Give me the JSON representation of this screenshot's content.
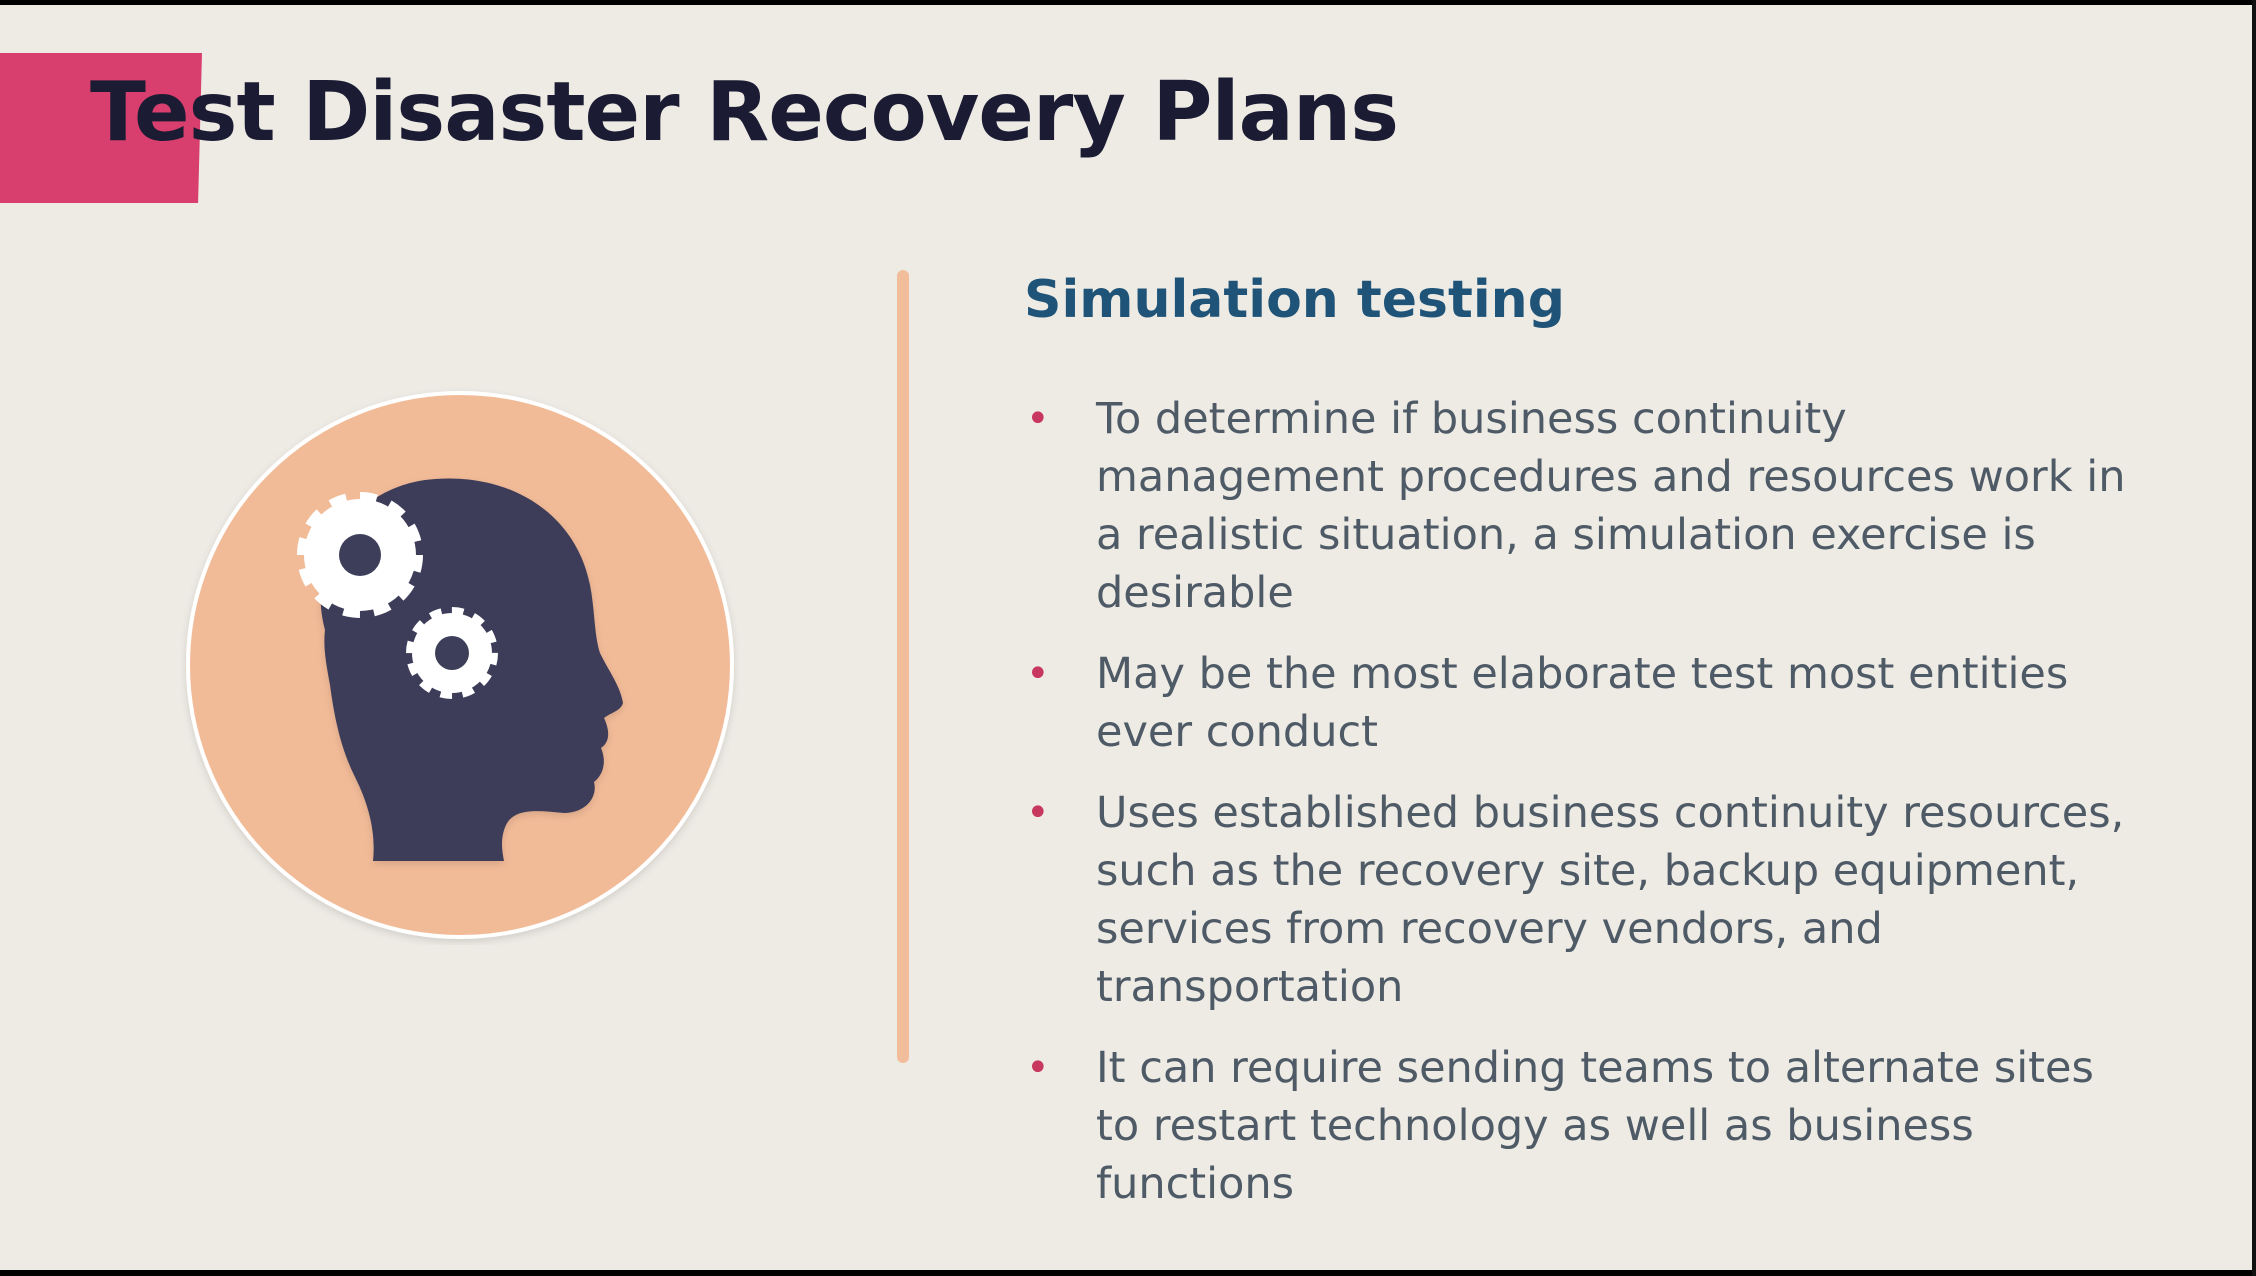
{
  "slide": {
    "title": "Test Disaster Recovery Plans",
    "section_heading": "Simulation testing",
    "bullet_marker": "•",
    "bullets": [
      "To determine if business continuity management procedures and resources work in a realistic situation, a simulation exercise is desirable",
      "May be the most elaborate test most entities ever conduct",
      "Uses established business continuity resources, such as the recovery site, backup equipment, services from recovery vendors, and transportation",
      "It can require sending teams to alternate sites to restart technology as well as business functions"
    ]
  },
  "illustration": {
    "icon": "head-with-gears-icon",
    "circle_color": "#f2bb98",
    "head_color": "#3d3e5a",
    "gear_color": "#ffffff"
  },
  "colors": {
    "background": "#eeebe5",
    "accent": "#d83f6e",
    "title": "#1b1c33",
    "heading": "#1f5478",
    "body_text": "#4e5a66",
    "divider": "#f2bd9b"
  }
}
